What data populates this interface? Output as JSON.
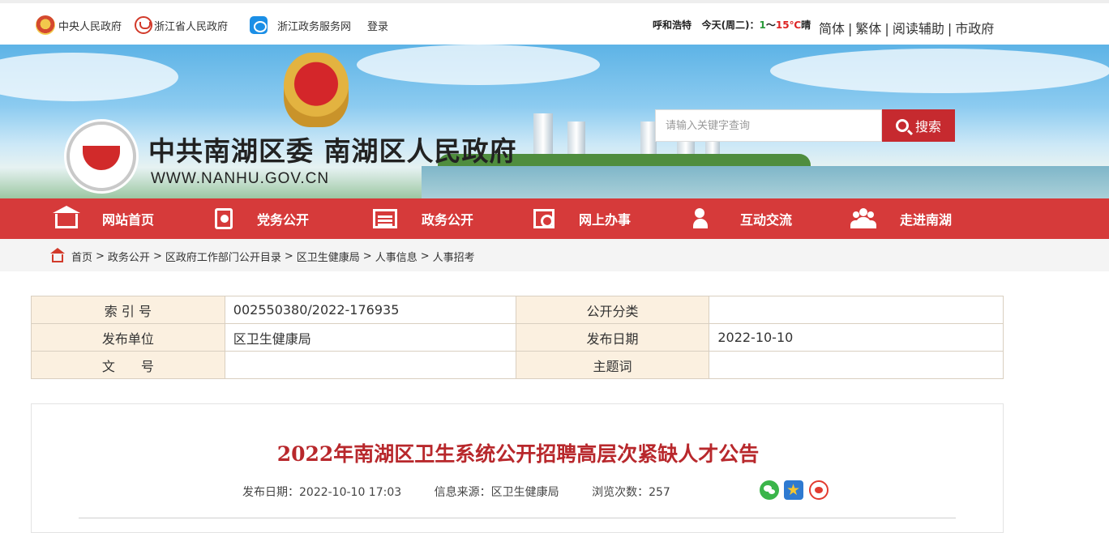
{
  "topbar": {
    "links": [
      {
        "label": "中央人民政府",
        "icon": "national-emblem-icon"
      },
      {
        "label": "浙江省人民政府",
        "icon": "zhejiang-logo-icon"
      },
      {
        "label": "浙江政务服务网",
        "icon": "zhejiang-service-icon"
      },
      {
        "label": "登录"
      }
    ],
    "weather": {
      "city": "呼和浩特",
      "day": "今天(周二)：",
      "low": "1",
      "sep": "～",
      "high": "15℃",
      "cond": "晴"
    },
    "tools": [
      "简体",
      "繁体",
      "阅读辅助",
      "市政府"
    ]
  },
  "banner": {
    "title": "中共南湖区委 南湖区人民政府",
    "url": "WWW.NANHU.GOV.CN",
    "search_placeholder": "请输入关键字查询",
    "search_label": "搜索"
  },
  "nav": [
    {
      "label": "网站首页",
      "icon": "home-icon"
    },
    {
      "label": "党务公开",
      "icon": "party-book-icon"
    },
    {
      "label": "政务公开",
      "icon": "gov-affairs-icon"
    },
    {
      "label": "网上办事",
      "icon": "online-service-icon"
    },
    {
      "label": "互动交流",
      "icon": "interaction-icon"
    },
    {
      "label": "走进南湖",
      "icon": "people-icon"
    }
  ],
  "breadcrumb": [
    "首页",
    "政务公开",
    "区政府工作部门公开目录",
    "区卫生健康局",
    "人事信息",
    "人事招考"
  ],
  "info": {
    "index_label": "索 引 号",
    "index_value": "002550380/2022-176935",
    "category_label": "公开分类",
    "category_value": "",
    "publisher_label": "发布单位",
    "publisher_value": "区卫生健康局",
    "date_label": "发布日期",
    "date_value": "2022-10-10",
    "docno_label": "文　　号",
    "docno_value": "",
    "keyword_label": "主题词",
    "keyword_value": ""
  },
  "article": {
    "title": "2022年南湖区卫生系统公开招聘高层次紧缺人才公告",
    "publish": "发布日期：2022-10-10 17:03",
    "source": "信息来源：区卫生健康局",
    "views": "浏览次数：257"
  },
  "colors": {
    "accent": "#d63a3a",
    "title_red": "#b8282c"
  }
}
